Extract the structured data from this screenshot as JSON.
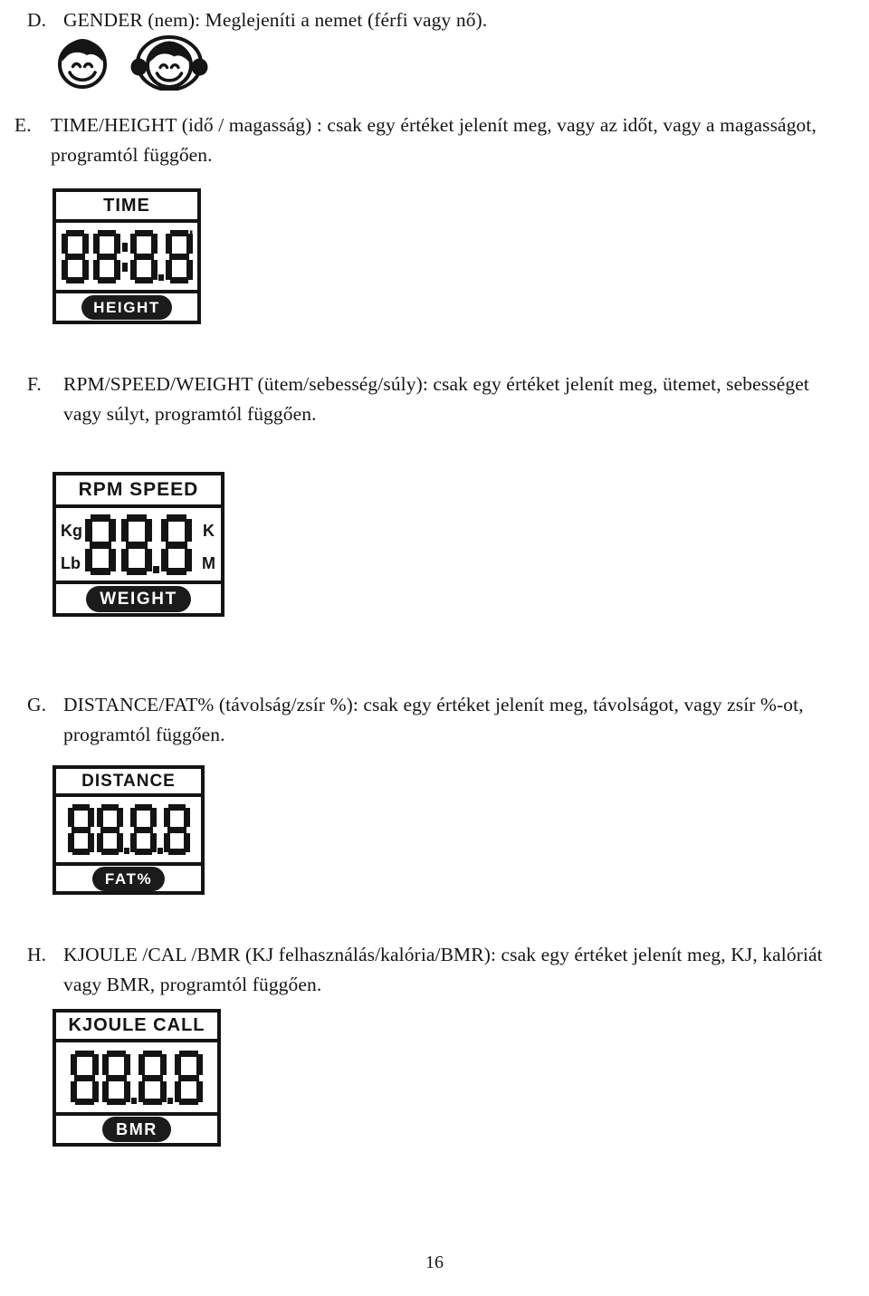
{
  "page": {
    "number": "16",
    "language": "hu"
  },
  "sections": [
    {
      "letter": "D.",
      "text": "GENDER (nem):    Meglejeníti a nemet (férfi vagy nő)."
    },
    {
      "letter": "E.",
      "text": "TIME/HEIGHT (idő / magasság) :    csak egy értéket jelenít meg, vagy az időt, vagy a magasságot, programtól függően."
    },
    {
      "letter": "F.",
      "text": "RPM/SPEED/WEIGHT (ütem/sebesség/súly): csak egy értéket jelenít meg, ütemet, sebességet vagy súlyt, programtól függően."
    },
    {
      "letter": "G.",
      "text": "DISTANCE/FAT% (távolság/zsír %): csak egy értéket jelenít meg, távolságot, vagy zsír %-ot, programtól függően."
    },
    {
      "letter": "H.",
      "text": "KJOULE /CAL /BMR (KJ felhasználás/kalória/BMR): csak egy értéket jelenít meg, KJ, kalóriát vagy BMR, programtól függően."
    }
  ],
  "gender_icons": {
    "male_label": "male-smiley-face",
    "female_label": "female-smiley-face"
  },
  "displays": [
    {
      "id": "time-height",
      "top_label": "TIME",
      "digits": "88:8.8",
      "bottom_label": "HEIGHT",
      "bottom_style": "pill-filled",
      "superscript": "\"",
      "left_labels": [],
      "right_labels": []
    },
    {
      "id": "rpm-speed-weight",
      "top_label": "RPM  SPEED",
      "digits": "88.8",
      "bottom_label": "WEIGHT",
      "bottom_style": "pill-filled",
      "superscript": "",
      "left_labels": [
        "Kg",
        "Lb"
      ],
      "right_labels": [
        "K",
        "M"
      ]
    },
    {
      "id": "distance-fat",
      "top_label": "DISTANCE",
      "digits": "88.8.8",
      "bottom_label": "FAT%",
      "bottom_style": "pill-filled",
      "superscript": "",
      "left_labels": [],
      "right_labels": []
    },
    {
      "id": "kjoule-cal-bmr",
      "top_label": "KJOULE  CALL",
      "digits": "88.8.8",
      "bottom_label": "BMR",
      "bottom_style": "pill-filled",
      "superscript": "",
      "left_labels": [],
      "right_labels": []
    }
  ]
}
